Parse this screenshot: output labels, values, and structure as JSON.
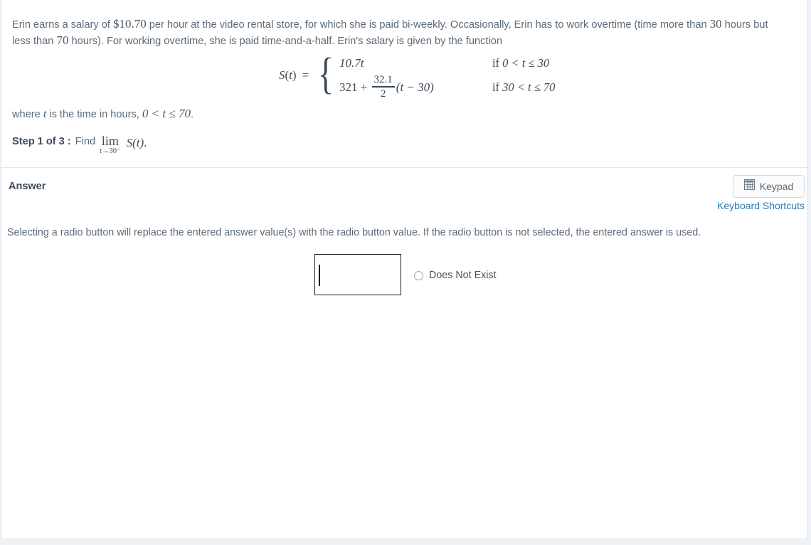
{
  "question": {
    "paragraph": {
      "seg1": "Erin earns a salary of ",
      "rate": "$10.70",
      "seg2": " per hour at the video rental store, for which she is paid bi-weekly.  Occasionally, Erin has to work overtime (time more than ",
      "overtime_threshold": "30",
      "seg3": " hours but less than ",
      "max_hours": "70",
      "seg4": " hours).  For working overtime, she is paid time-and-a-half.  Erin's salary is given by the function"
    },
    "formula": {
      "function_name": "S",
      "variable": "t",
      "equals": "=",
      "cases": [
        {
          "expression": "10.7t",
          "condition_prefix": "if",
          "condition": "0 < t ≤ 30"
        },
        {
          "expr_lead": "321 +",
          "numerator": "32.1",
          "denominator": "2",
          "expr_tail": "(t − 30)",
          "condition_prefix": "if",
          "condition": "30 < t ≤ 70"
        }
      ]
    },
    "where_line": {
      "prefix": "where ",
      "variable": "t",
      "mid": " is the time in hours, ",
      "domain": "0 < t ≤ 70",
      "period": "."
    },
    "step": {
      "label": "Step 1 of 3 :",
      "instruction": "Find",
      "limit_operator": "lim",
      "limit_subscript": "t→30⁻",
      "limit_function": "S(t)",
      "period": "."
    }
  },
  "answer_section": {
    "heading": "Answer",
    "keypad_button": {
      "label": "Keypad",
      "icon": "keypad-grid-icon"
    },
    "keyboard_shortcuts_link": "Keyboard Shortcuts",
    "radio_note": "Selecting a radio button will replace the entered answer value(s) with the radio button value. If the radio button is not selected, the entered answer is used.",
    "answer_field": {
      "value": "",
      "placeholder": ""
    },
    "does_not_exist": {
      "label": "Does Not Exist",
      "selected": false
    }
  },
  "colors": {
    "body_text": "#5b6a78",
    "math_text": "#3c4a58",
    "link_blue": "#2a7ab0",
    "border_grey": "#e4e7eb",
    "page_background": "#eef1f5"
  }
}
